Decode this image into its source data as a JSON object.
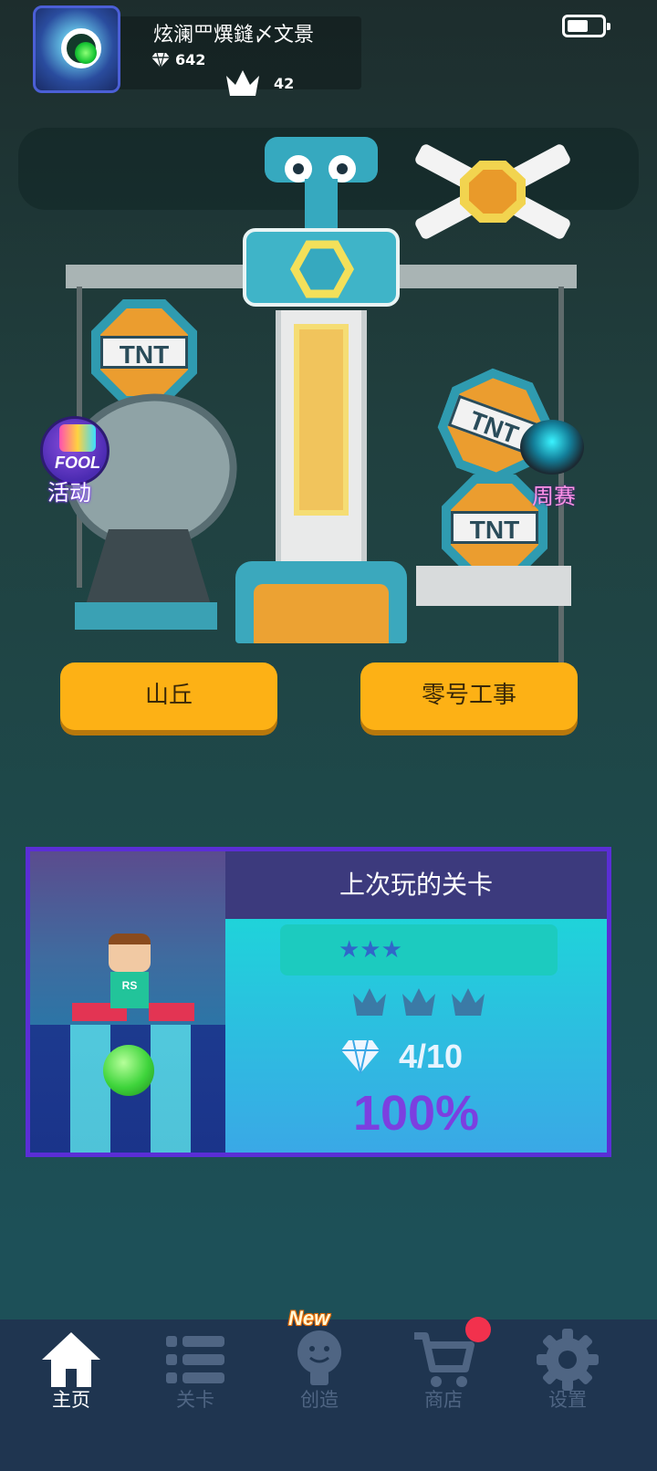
{
  "profile": {
    "username": "炫澜罒熼鏠〆文景",
    "gems": "642",
    "crowns": "42"
  },
  "battery": {
    "level": 0.6
  },
  "scene": {
    "tnt_label": "TNT",
    "event_badge_text": "FOOL",
    "event_label": "活动",
    "weekly_label": "周赛"
  },
  "level_buttons": {
    "left": "山丘",
    "right": "零号工事"
  },
  "last_played": {
    "title": "上次玩的关卡",
    "stars": "★★★",
    "char_shirt": "RS",
    "gem_count": "4/10",
    "percent": "100%"
  },
  "nav": {
    "items": [
      {
        "label": "主页",
        "icon": "home-icon",
        "active": true
      },
      {
        "label": "关卡",
        "icon": "list-icon",
        "active": false
      },
      {
        "label": "创造",
        "icon": "create-icon",
        "active": false
      },
      {
        "label": "商店",
        "icon": "cart-icon",
        "active": false
      },
      {
        "label": "设置",
        "icon": "gear-icon",
        "active": false
      }
    ],
    "new_badge": "New"
  },
  "colors": {
    "button": "#fdb115",
    "card_border": "#5b2ed6",
    "nav_bg": "#1f3550",
    "percent": "#7c3fe0"
  }
}
